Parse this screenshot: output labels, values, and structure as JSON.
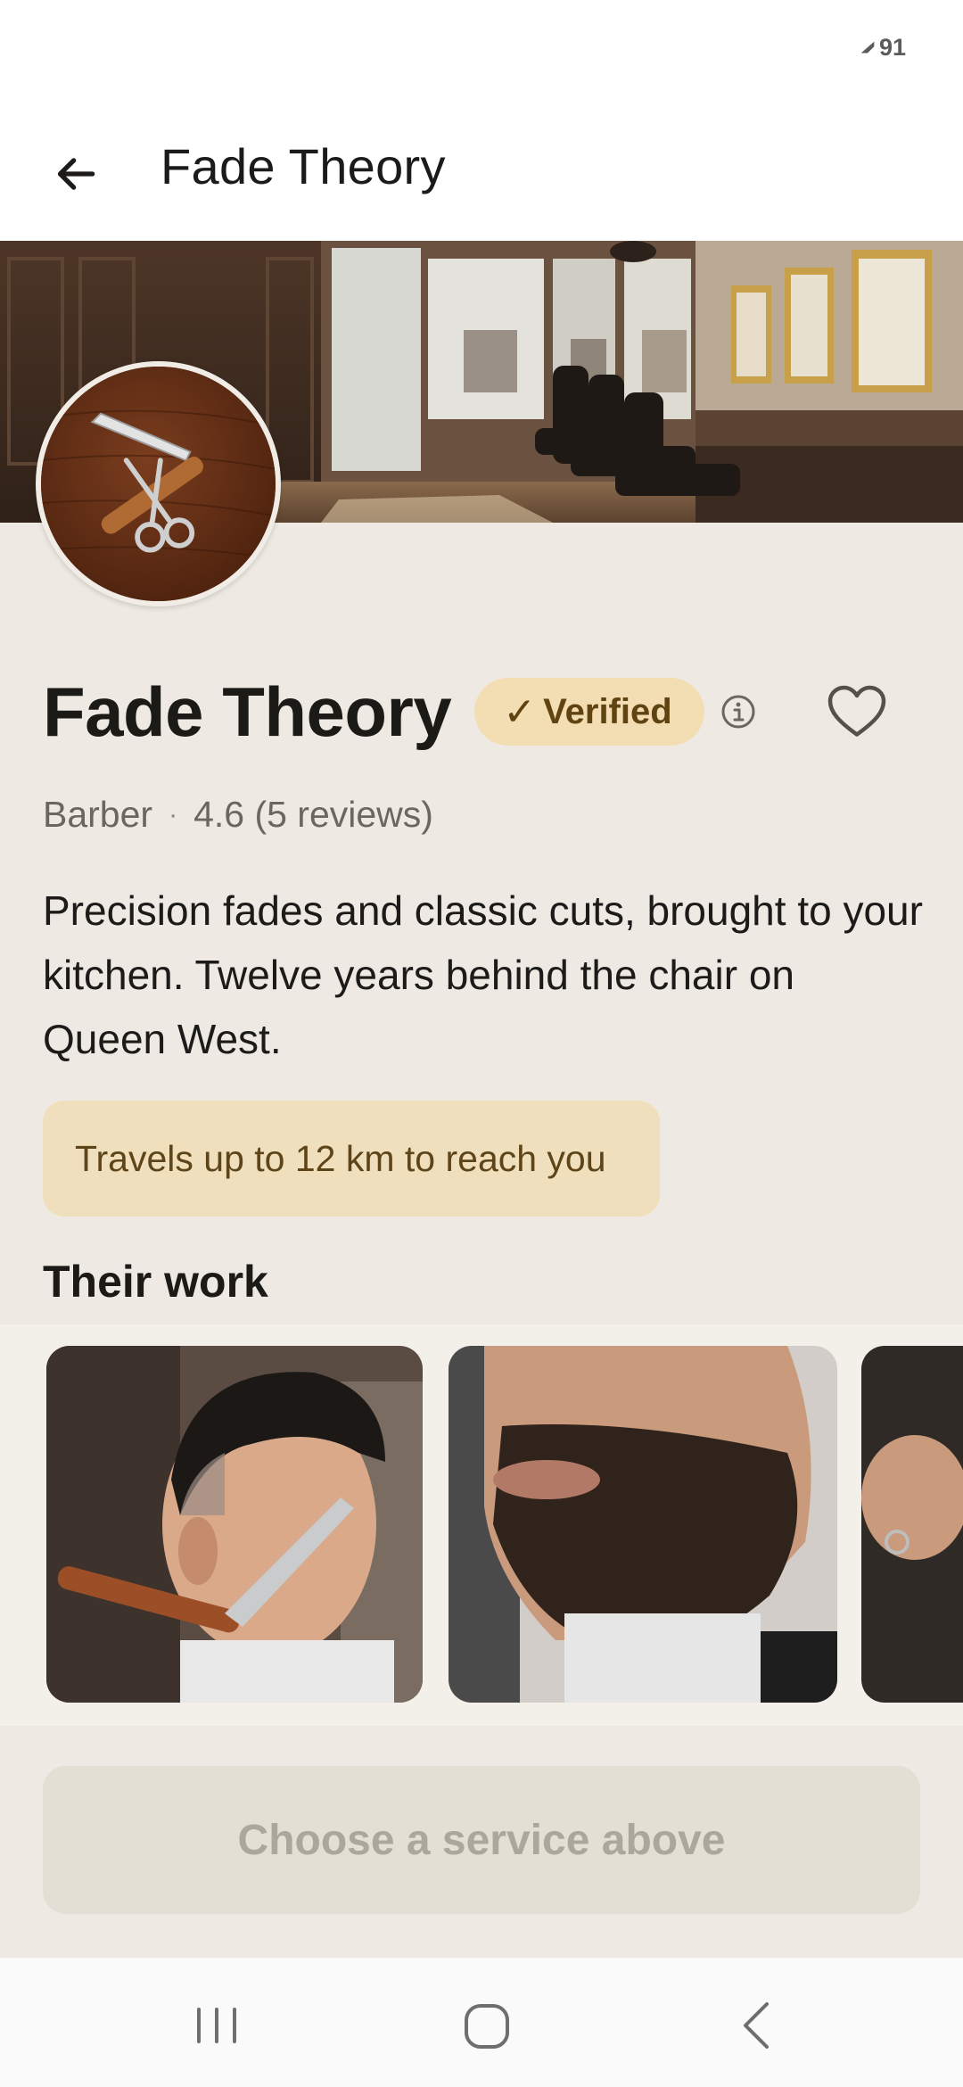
{
  "status_bar": {
    "battery_level": "91",
    "battery_icon": "charging-icon"
  },
  "app_bar": {
    "title": "Fade Theory",
    "back_icon": "back-arrow-icon"
  },
  "provider": {
    "name": "Fade Theory",
    "verified_label": "Verified",
    "verified_check": "✓",
    "category": "Barber",
    "separator": "·",
    "rating_text": "4.6 (5 reviews)",
    "description": "Precision fades and classic cuts, brought to your kitchen. Twelve years behind the chair on Queen West.",
    "travel_note": "Travels up to 12 km to reach you"
  },
  "gallery": {
    "title": "Their work"
  },
  "cta": {
    "label": "Choose a service above"
  },
  "colors": {
    "background": "#eeeae3",
    "verified_badge": "#f2deb2",
    "travel_pill": "#f0dfbd",
    "cta_disabled": "#e4dfd5"
  }
}
